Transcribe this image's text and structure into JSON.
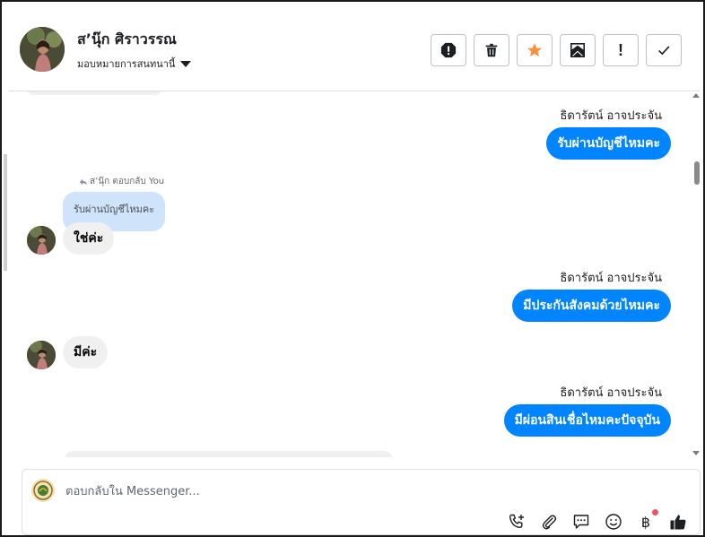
{
  "header": {
    "contact_name": "ส’นุ๊ก ศิราวรรณ",
    "assign_label": "มอบหมายการสนทนานี้",
    "actions": [
      {
        "name": "spam-button",
        "icon": "alert-octagon-icon"
      },
      {
        "name": "delete-button",
        "icon": "trash-icon"
      },
      {
        "name": "star-button",
        "icon": "star-icon"
      },
      {
        "name": "mark-unread-button",
        "icon": "mail-icon"
      },
      {
        "name": "follow-up-button",
        "icon": "exclamation-icon"
      },
      {
        "name": "done-button",
        "icon": "check-icon"
      }
    ],
    "follow_up_glyph": "!"
  },
  "messages": [
    {
      "direction": "out",
      "sender": "ธิดารัตน์ อาจประจัน",
      "text": "รับผ่านบัญชีไหมคะ"
    },
    {
      "direction": "in",
      "reply_meta": "ส’นุ๊ก ตอบกลับ You",
      "quoted": "รับผ่านบัญชีไหมคะ",
      "text": "ใช่ค่ะ"
    },
    {
      "direction": "out",
      "sender": "ธิดารัตน์ อาจประจัน",
      "text": "มีประกันสังคมด้วยไหมคะ"
    },
    {
      "direction": "in",
      "text": "มีค่ะ"
    },
    {
      "direction": "out",
      "sender": "ธิดารัตน์ อาจประจัน",
      "text": "มีผ่อนสินเชื่อไหมคะปัจจุบัน"
    }
  ],
  "composer": {
    "placeholder": "ตอบกลับใน Messenger...",
    "tools": [
      "call-plus-icon",
      "paperclip-icon",
      "chat-bubble-icon",
      "emoji-icon",
      "baht-icon",
      "thumbs-up-icon"
    ],
    "baht_glyph": "฿"
  },
  "colors": {
    "outgoing_bubble": "#0084ff",
    "incoming_bubble": "#f0f0f0",
    "quoted_bubble": "#cfe3fb",
    "star": "#f7923a",
    "notification_dot": "#f25268"
  }
}
